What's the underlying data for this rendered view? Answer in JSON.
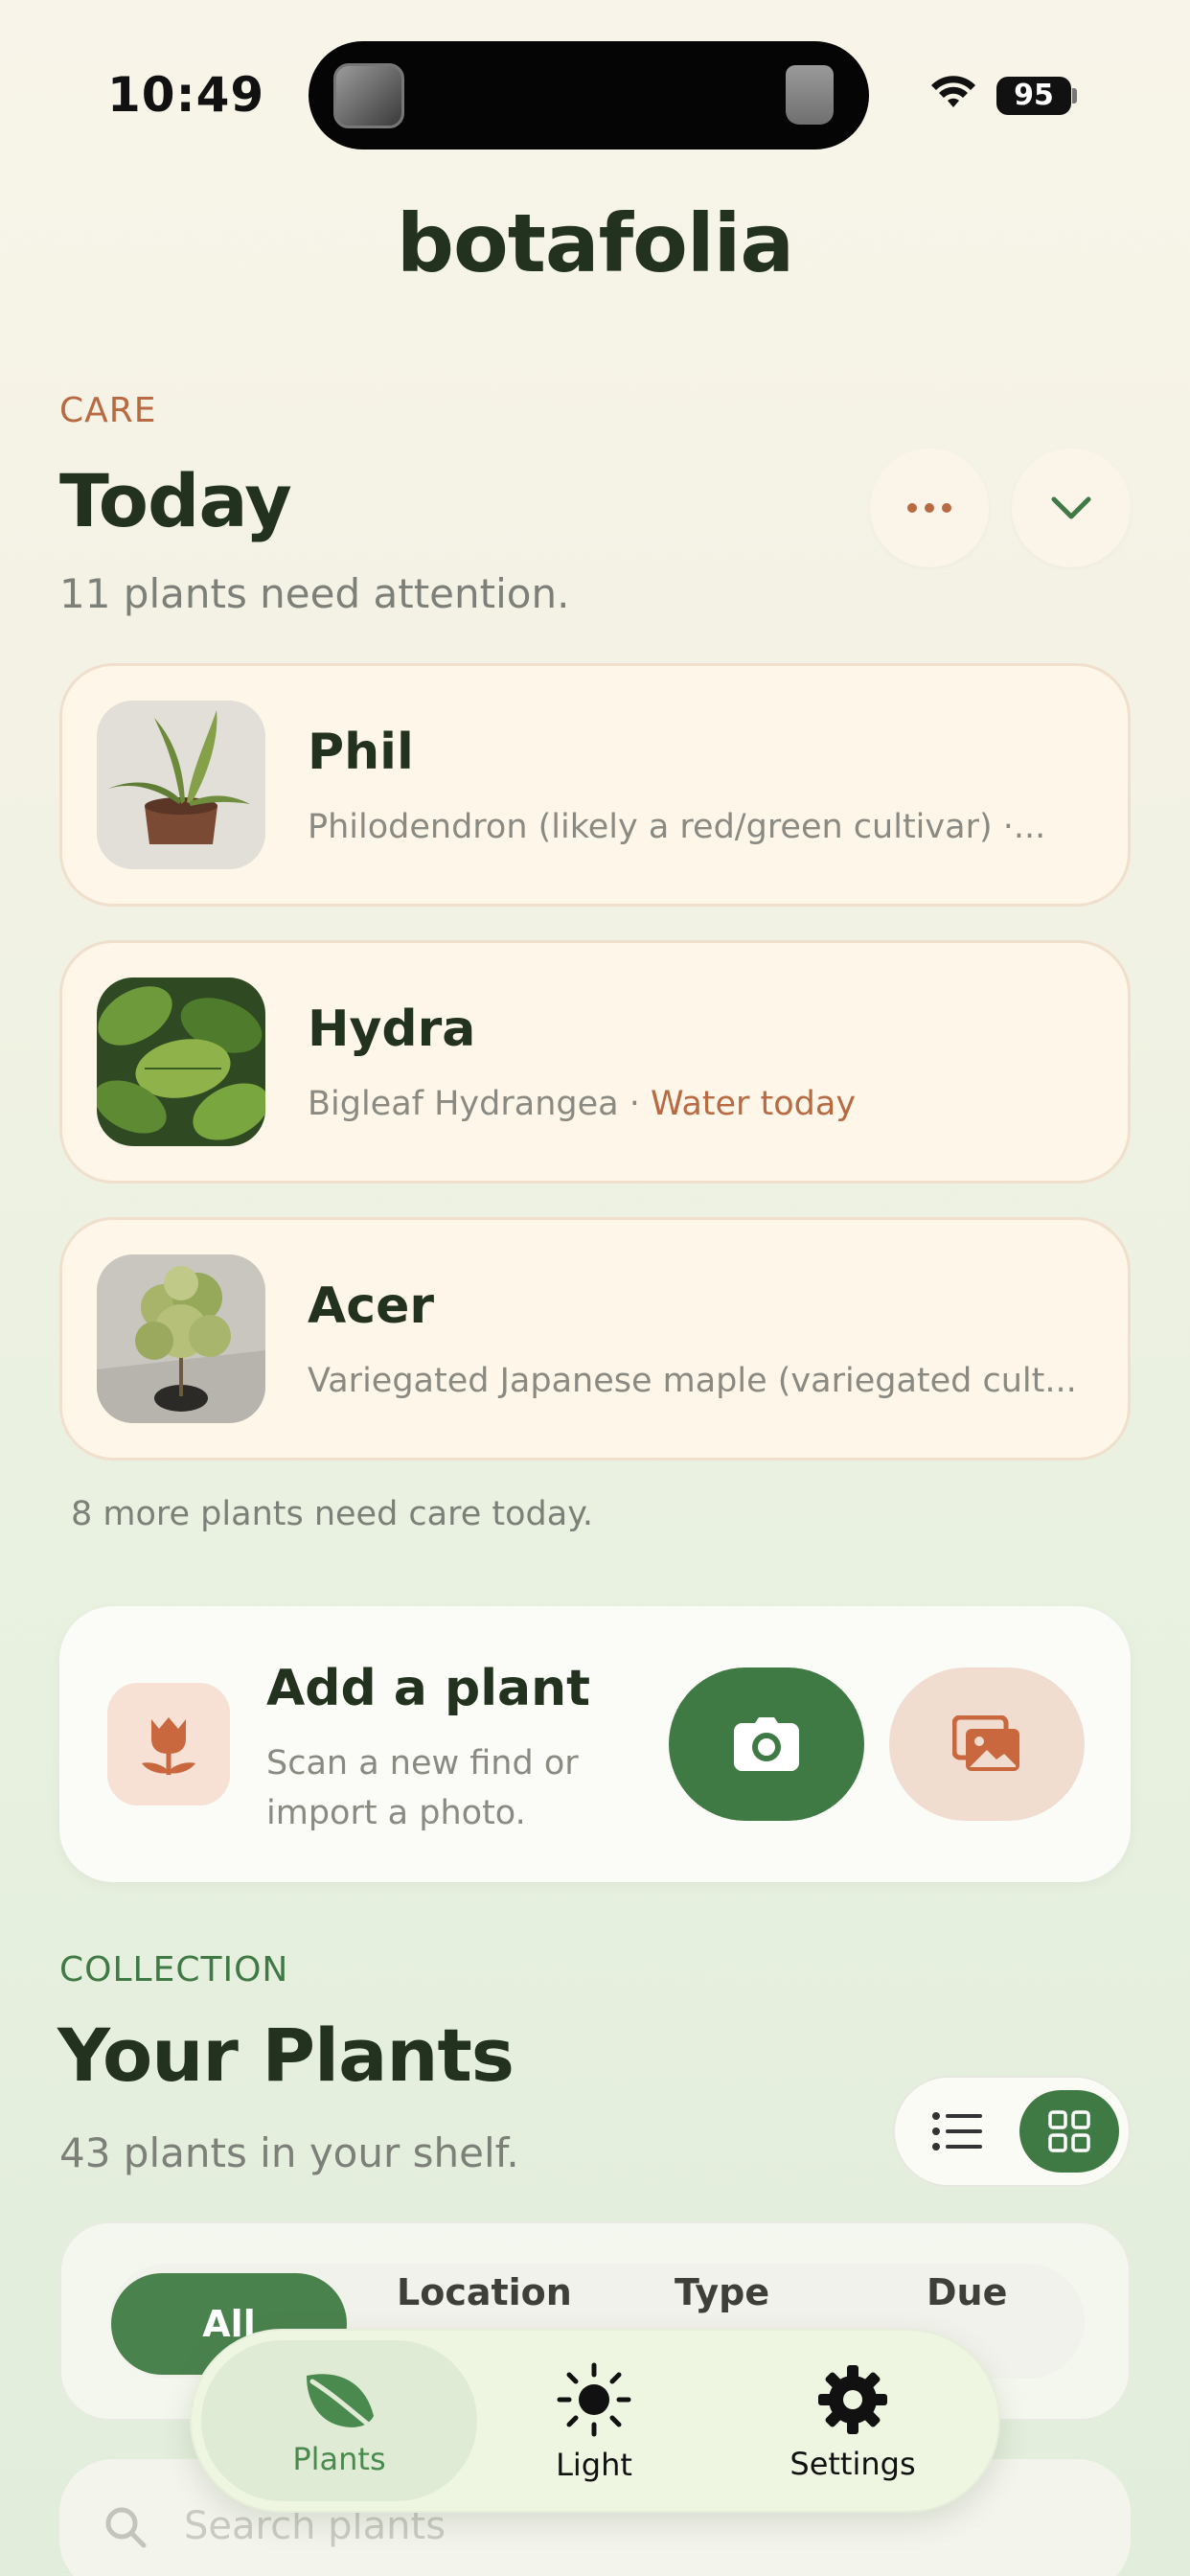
{
  "status_bar": {
    "time": "10:49",
    "battery": "95"
  },
  "app_title": "botafolia",
  "care": {
    "eyebrow": "CARE",
    "title": "Today",
    "subtitle": "11 plants need attention.",
    "cards": [
      {
        "name": "Phil",
        "desc": "Philodendron (likely a red/green cultivar) ·...",
        "due": ""
      },
      {
        "name": "Hydra",
        "desc": "Bigleaf Hydrangea · ",
        "due": "Water today"
      },
      {
        "name": "Acer",
        "desc": "Variegated Japanese maple (variegated cult...",
        "due": ""
      }
    ],
    "more_note": "8 more plants need care today."
  },
  "add_plant": {
    "title": "Add a plant",
    "subtitle": "Scan a new find or import a photo."
  },
  "collection": {
    "eyebrow": "COLLECTION",
    "title": "Your Plants",
    "subtitle": "43 plants in your shelf.",
    "filters": [
      "All",
      "Location",
      "Type",
      "Due"
    ],
    "search_placeholder": "Search plants"
  },
  "tabbar": {
    "tabs": [
      {
        "label": "Plants",
        "icon": "leaf-icon"
      },
      {
        "label": "Light",
        "icon": "sun-icon"
      },
      {
        "label": "Settings",
        "icon": "gear-icon"
      }
    ]
  },
  "colors": {
    "accent_green": "#3f7a45",
    "accent_terracotta": "#b86a43",
    "text_dark": "#22321f"
  }
}
